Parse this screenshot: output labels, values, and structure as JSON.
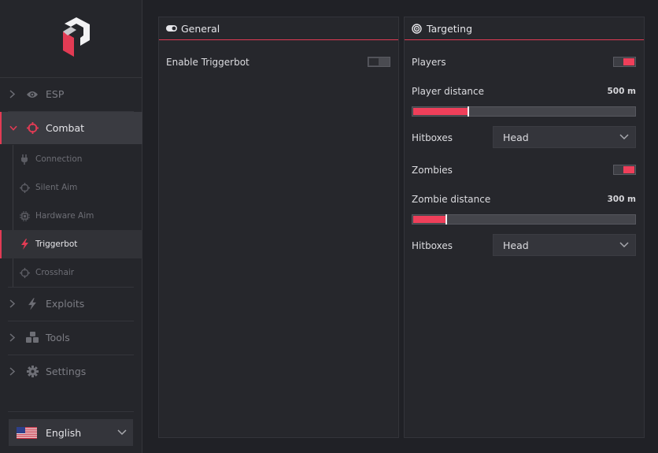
{
  "sidebar": {
    "nav": [
      {
        "label": "ESP"
      },
      {
        "label": "Combat"
      },
      {
        "label": "Exploits"
      },
      {
        "label": "Tools"
      },
      {
        "label": "Settings"
      }
    ],
    "combat_sub": [
      {
        "label": "Connection"
      },
      {
        "label": "Silent Aim"
      },
      {
        "label": "Hardware Aim"
      },
      {
        "label": "Triggerbot"
      },
      {
        "label": "Crosshair"
      }
    ],
    "language": {
      "label": "English"
    }
  },
  "general": {
    "title": "General",
    "enable_triggerbot": {
      "label": "Enable Triggerbot",
      "enabled": false
    }
  },
  "targeting": {
    "title": "Targeting",
    "players": {
      "label": "Players",
      "enabled": true
    },
    "player_distance": {
      "label": "Player distance",
      "value_text": "500 m",
      "fraction": 0.25
    },
    "player_hitboxes": {
      "label": "Hitboxes",
      "value": "Head"
    },
    "zombies": {
      "label": "Zombies",
      "enabled": true
    },
    "zombie_distance": {
      "label": "Zombie distance",
      "value_text": "300 m",
      "fraction": 0.15
    },
    "zombie_hitboxes": {
      "label": "Hitboxes",
      "value": "Head"
    }
  },
  "colors": {
    "accent": "#e23b54",
    "background": "#202126",
    "panel": "#26272c",
    "sidebar": "#25262b"
  }
}
